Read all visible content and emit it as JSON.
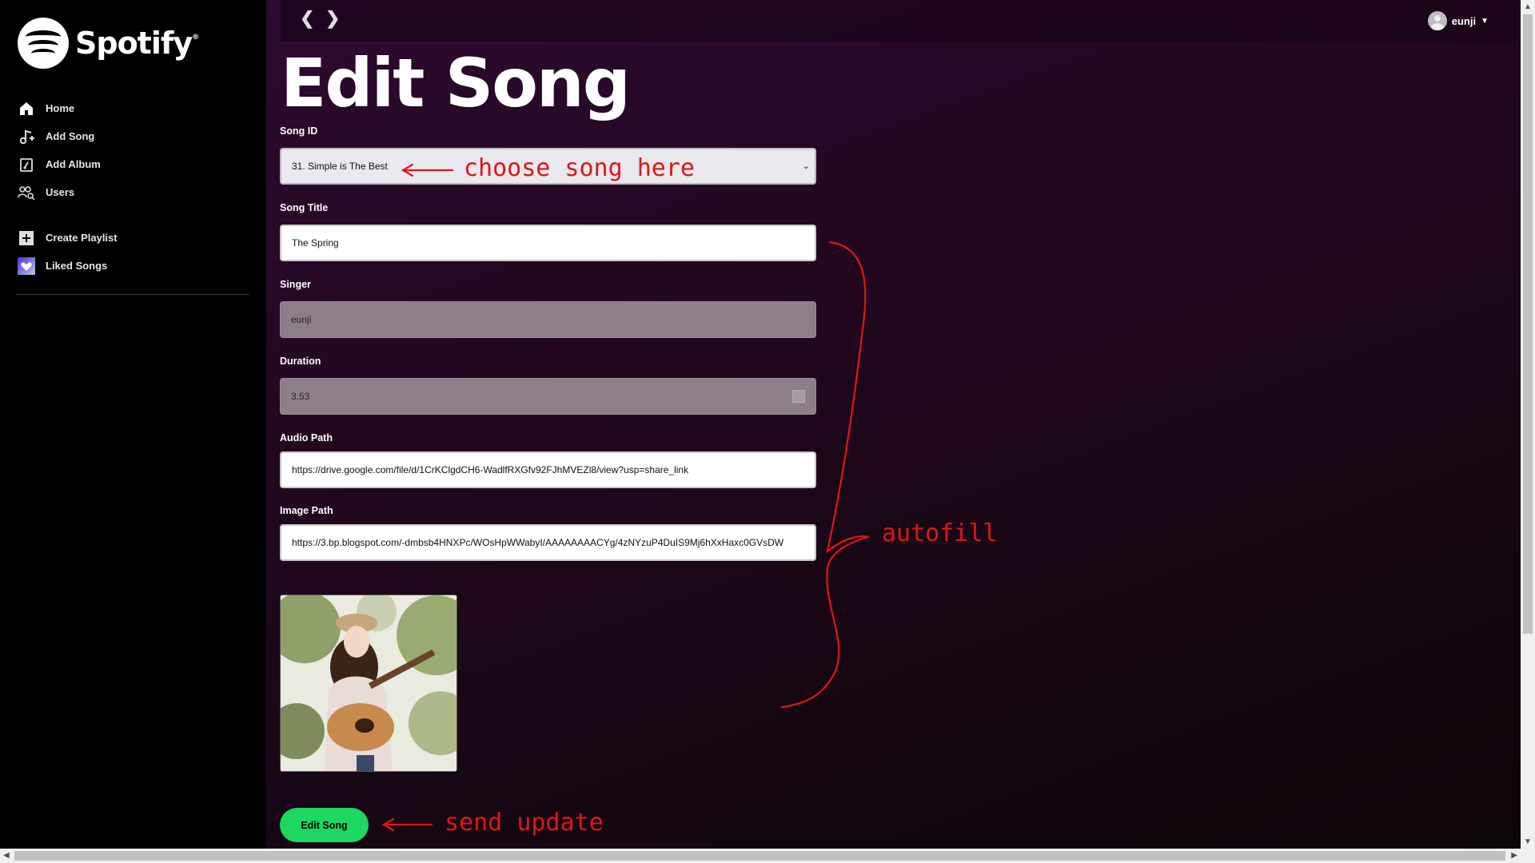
{
  "app": {
    "logo_text": "Spotify",
    "logo_reg": "®"
  },
  "sidebar": {
    "items": [
      {
        "label": "Home",
        "icon": "home-icon"
      },
      {
        "label": "Add Song",
        "icon": "add-song-icon"
      },
      {
        "label": "Add Album",
        "icon": "add-album-icon"
      },
      {
        "label": "Users",
        "icon": "users-icon"
      },
      {
        "label": "Create Playlist",
        "icon": "plus-square-icon"
      },
      {
        "label": "Liked Songs",
        "icon": "heart-icon"
      }
    ]
  },
  "topbar": {
    "back": "❮",
    "forward": "❯",
    "user_name": "eunji",
    "caret": "▼"
  },
  "page": {
    "title": "Edit Song"
  },
  "form": {
    "song_id": {
      "label": "Song ID",
      "value": "31. Simple is The Best"
    },
    "song_title": {
      "label": "Song Title",
      "value": "The Spring"
    },
    "singer": {
      "label": "Singer",
      "value": "eunji"
    },
    "duration": {
      "label": "Duration",
      "value": "3.53"
    },
    "audio_path": {
      "label": "Audio Path",
      "value": "https://drive.google.com/file/d/1CrKClgdCH6-WadlfRXGfv92FJhMVEZl8/view?usp=share_link"
    },
    "image_path": {
      "label": "Image Path",
      "value": "https://3.bp.blogspot.com/-dmbsb4HNXPc/WOsHpWWabyI/AAAAAAAACYg/4zNYzuP4DuIS9Mj6hXxHaxc0GVsDW"
    },
    "submit_label": "Edit Song"
  },
  "annotations": {
    "choose": "choose song here",
    "autofill": "autofill",
    "send": "send update"
  },
  "colors": {
    "accent": "#1ed760",
    "annotation": "#e01515"
  }
}
